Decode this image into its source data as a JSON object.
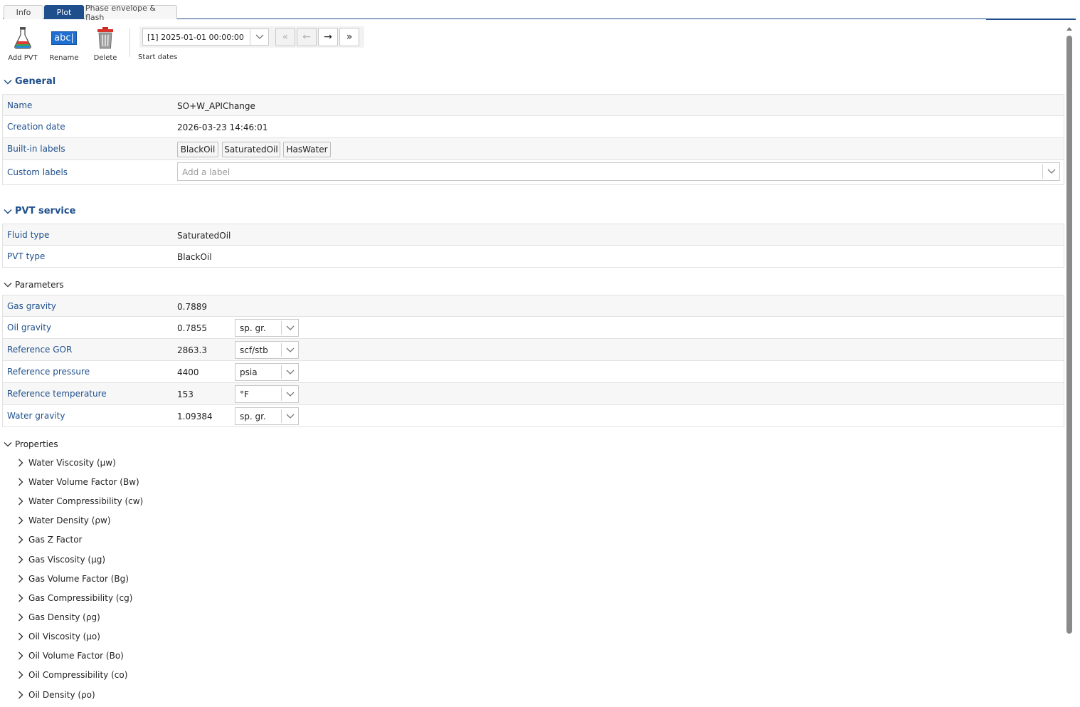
{
  "tabs": [
    {
      "label": "Info"
    },
    {
      "label": "Plot"
    },
    {
      "label": "Phase envelope & flash"
    }
  ],
  "toolbar": {
    "add_pvt": "Add PVT",
    "rename": "Rename",
    "rename_icon_text": "abc|",
    "delete": "Delete",
    "start_dates_label": "Start dates",
    "date_value": "[1] 2025-01-01 00:00:00"
  },
  "general": {
    "title": "General",
    "name_label": "Name",
    "name_value": "SO+W_APIChange",
    "creation_label": "Creation date",
    "creation_value": "2026-03-23 14:46:01",
    "builtin_label": "Built-in labels",
    "builtin": [
      "BlackOil",
      "SaturatedOil",
      "HasWater"
    ],
    "custom_label": "Custom labels",
    "custom_placeholder": "Add a label"
  },
  "pvt_service": {
    "title": "PVT service",
    "fluid_label": "Fluid type",
    "fluid_value": "SaturatedOil",
    "pvt_label": "PVT type",
    "pvt_value": "BlackOil"
  },
  "parameters": {
    "title": "Parameters",
    "rows": [
      {
        "label": "Gas gravity",
        "value": "0.7889",
        "unit": ""
      },
      {
        "label": "Oil gravity",
        "value": "0.7855",
        "unit": "sp. gr."
      },
      {
        "label": "Reference GOR",
        "value": "2863.3",
        "unit": "scf/stb"
      },
      {
        "label": "Reference pressure",
        "value": "4400",
        "unit": "psia"
      },
      {
        "label": "Reference temperature",
        "value": "153",
        "unit": "°F"
      },
      {
        "label": "Water gravity",
        "value": "1.09384",
        "unit": "sp. gr."
      }
    ]
  },
  "properties": {
    "title": "Properties",
    "items": [
      "Water Viscosity (μw)",
      "Water Volume Factor (Bw)",
      "Water Compressibility (cw)",
      "Water Density (ρw)",
      "Gas Z Factor",
      "Gas Viscosity (μg)",
      "Gas Volume Factor (Bg)",
      "Gas Compressibility (cg)",
      "Gas Density (ρg)",
      "Oil Viscosity (μo)",
      "Oil Volume Factor (Bo)",
      "Oil Compressibility (co)",
      "Oil Density (ρo)"
    ]
  },
  "colors": {
    "accent": "#1e4f8c",
    "delete_red": "#d9342b"
  }
}
